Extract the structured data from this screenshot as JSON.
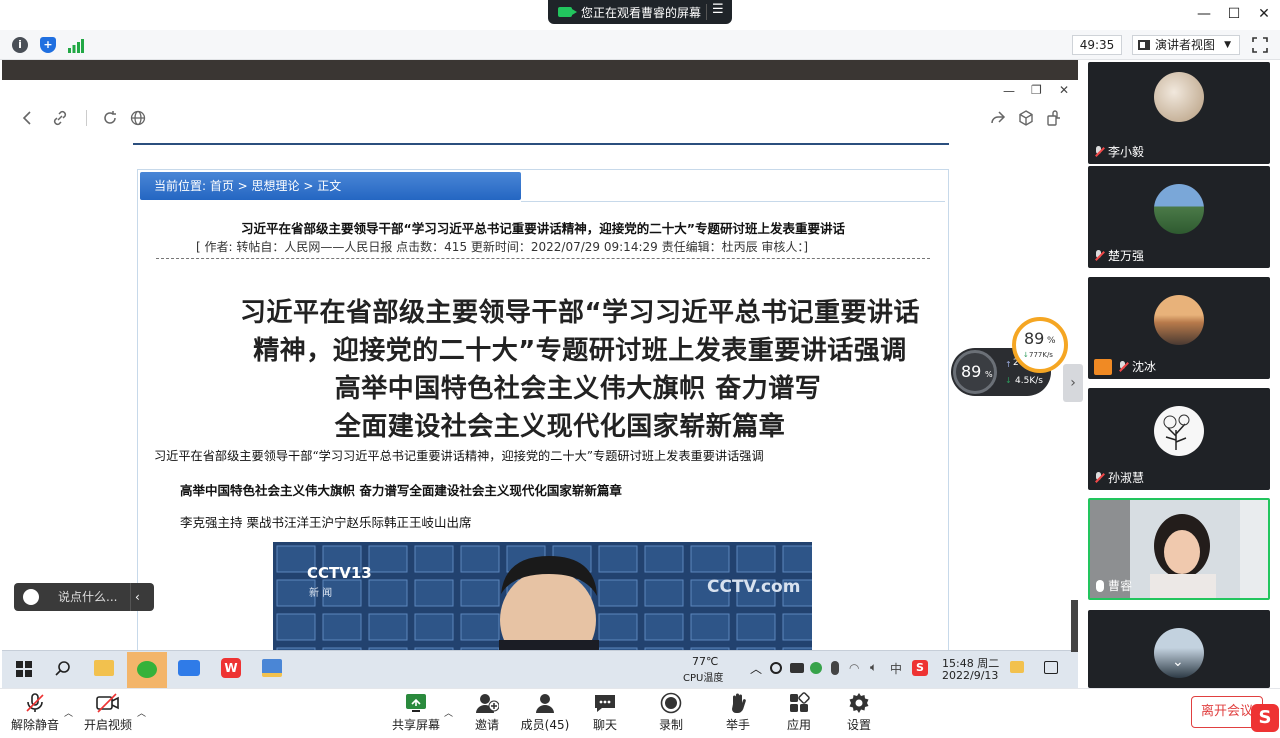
{
  "window": {
    "sharing_banner": "您正在观看曹睿的屏幕",
    "menu_glyph": "☰",
    "minimize": "—",
    "maximize": "☐",
    "close": "✕"
  },
  "toolbar": {
    "timer": "49:35",
    "view_mode": "演讲者视图",
    "icons": [
      "info-icon",
      "shield-icon",
      "signal-bars-icon",
      "speaker-view-icon",
      "fullscreen-icon"
    ]
  },
  "shared_window": {
    "controls": [
      "minimize",
      "restore",
      "close"
    ]
  },
  "browser": {
    "nav_icons": [
      "back-icon",
      "link-icon",
      "refresh-icon",
      "globe-icon",
      "share-icon",
      "cube-icon",
      "extension-icon"
    ]
  },
  "article": {
    "breadcrumb": "当前位置: 首页 > 思想理论 > 正文",
    "title": "习近平在省部级主要领导干部“学习习近平总书记重要讲话精神，迎接党的二十大”专题研讨班上发表重要讲话",
    "meta": "[ 作者:      转帖自：人民网——人民日报          点击数：415    更新时间：2022/07/29 09:14:29    责任编辑：杜丙辰     审核人：]",
    "headline_lines": [
      "习近平在省部级主要领导干部“学习习近平总书记重要讲话",
      "精神，迎接党的二十大”专题研讨班上发表重要讲话强调",
      "高举中国特色社会主义伟大旗帜 奋力谱写",
      "全面建设社会主义现代化国家崭新篇章"
    ],
    "para1": "习近平在省部级主要领导干部“学习习近平总书记重要讲话精神，迎接党的二十大”专题研讨班上发表重要讲话强调",
    "para2": "高举中国特色社会主义伟大旗帜 奋力谱写全面建设社会主义现代化国家崭新篇章",
    "para3": "李克强主持  栗战书汪洋王沪宁赵乐际韩正王岐山出席",
    "video_logo_left": "CCTV13",
    "video_logo_left_sub": "新 闻",
    "video_logo_right": "CCTV.com"
  },
  "chat_bubble": {
    "placeholder": "说点什么..."
  },
  "net_widget": {
    "cpu_percent": "89",
    "percent_sign": "%",
    "up_speed": "2",
    "down_speed": "4.5K/s",
    "gauge_percent": "89",
    "gauge_sub": "777K/s"
  },
  "taskbar": {
    "apps": [
      "windows-start-icon",
      "search-icon",
      "file-explorer-icon",
      "wechat-icon",
      "tencent-meeting-icon",
      "wps-icon",
      "app-icon"
    ],
    "temperature": "77℃",
    "temperature_label": "CPU温度",
    "ime": "中",
    "clock_time": "15:48 周二",
    "clock_date": "2022/9/13"
  },
  "participants": [
    {
      "name": "李小毅",
      "mic": "muted"
    },
    {
      "name": "楚万强",
      "mic": "muted"
    },
    {
      "name": "沈冰",
      "mic": "muted",
      "badge": "host"
    },
    {
      "name": "孙淑慧",
      "mic": "muted"
    },
    {
      "name": "曹睿",
      "mic": "on",
      "video": true
    },
    {
      "name": "",
      "mic": "muted"
    }
  ],
  "controls": {
    "unmute": "解除静音",
    "start_video": "开启视频",
    "share_screen": "共享屏幕",
    "invite": "邀请",
    "members": "成员(45)",
    "chat": "聊天",
    "record": "录制",
    "raise_hand": "举手",
    "apps": "应用",
    "settings": "设置",
    "leave": "离开会议"
  },
  "colors": {
    "accent_green": "#22c55e",
    "leave_red": "#e04040",
    "breadcrumb_blue": "#2466c2",
    "gauge_orange": "#f5a623"
  }
}
